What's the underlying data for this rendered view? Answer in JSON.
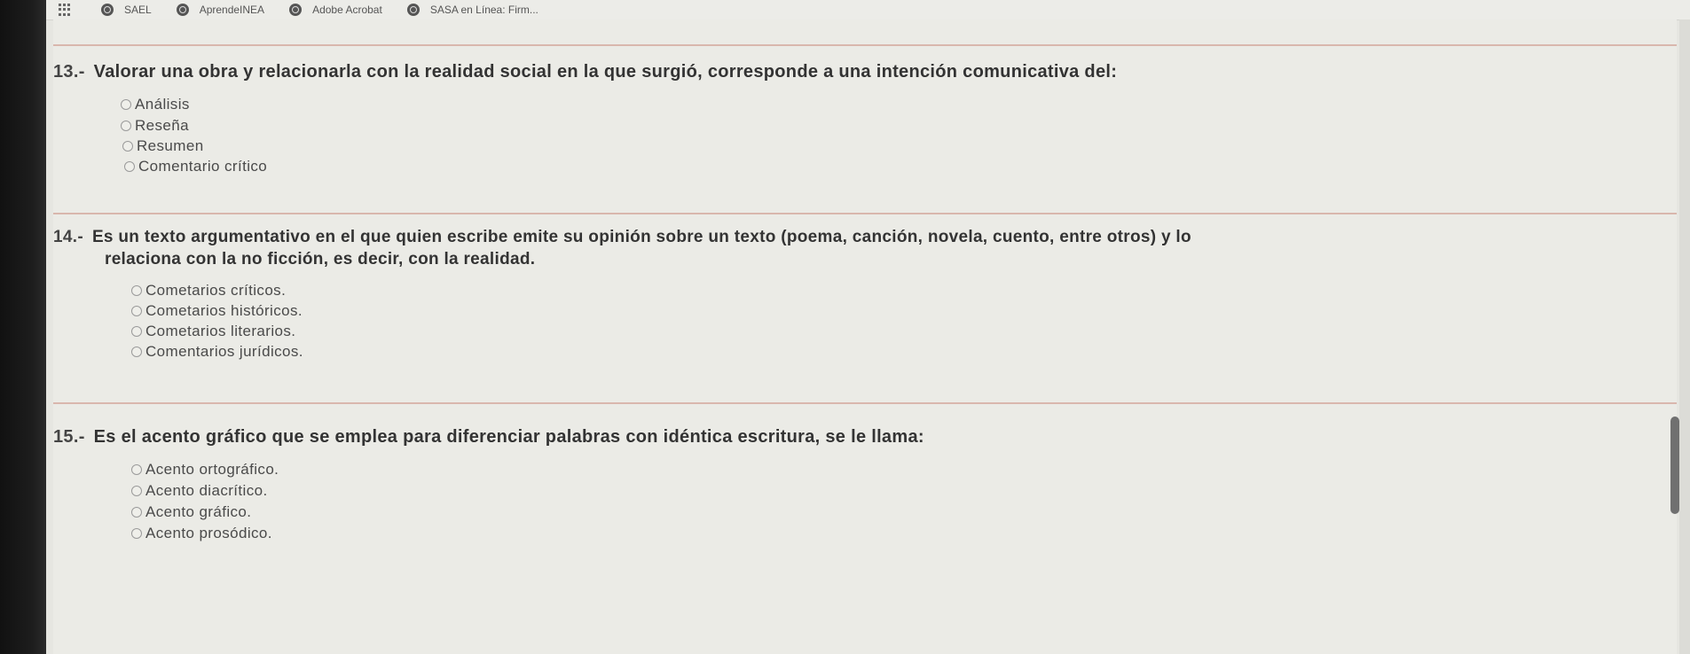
{
  "bookmarks": {
    "apps_label": "apps",
    "items": [
      "SAEL",
      "AprendeINEA",
      "Adobe Acrobat",
      "SASA en Línea: Firm..."
    ]
  },
  "questions": [
    {
      "number": "13.-",
      "text": "Valorar una obra y relacionarla con la realidad social en la que surgió, corresponde a una intención comunicativa del:",
      "options": [
        "Análisis",
        "Reseña",
        "Resumen",
        "Comentario crítico"
      ]
    },
    {
      "number": "14.-",
      "text_line1": "Es un texto argumentativo en el que quien escribe emite su opinión sobre un texto (poema, canción, novela, cuento, entre otros) y lo",
      "text_line2": "relaciona con la no ficción, es decir, con la realidad.",
      "options": [
        "Cometarios críticos.",
        "Cometarios históricos.",
        "Cometarios literarios.",
        "Comentarios jurídicos."
      ]
    },
    {
      "number": "15.-",
      "text": "Es el acento gráfico que se emplea para diferenciar palabras con idéntica escritura, se le llama:",
      "options": [
        "Acento ortográfico.",
        "Acento diacrítico.",
        "Acento gráfico.",
        "Acento prosódico."
      ]
    }
  ]
}
